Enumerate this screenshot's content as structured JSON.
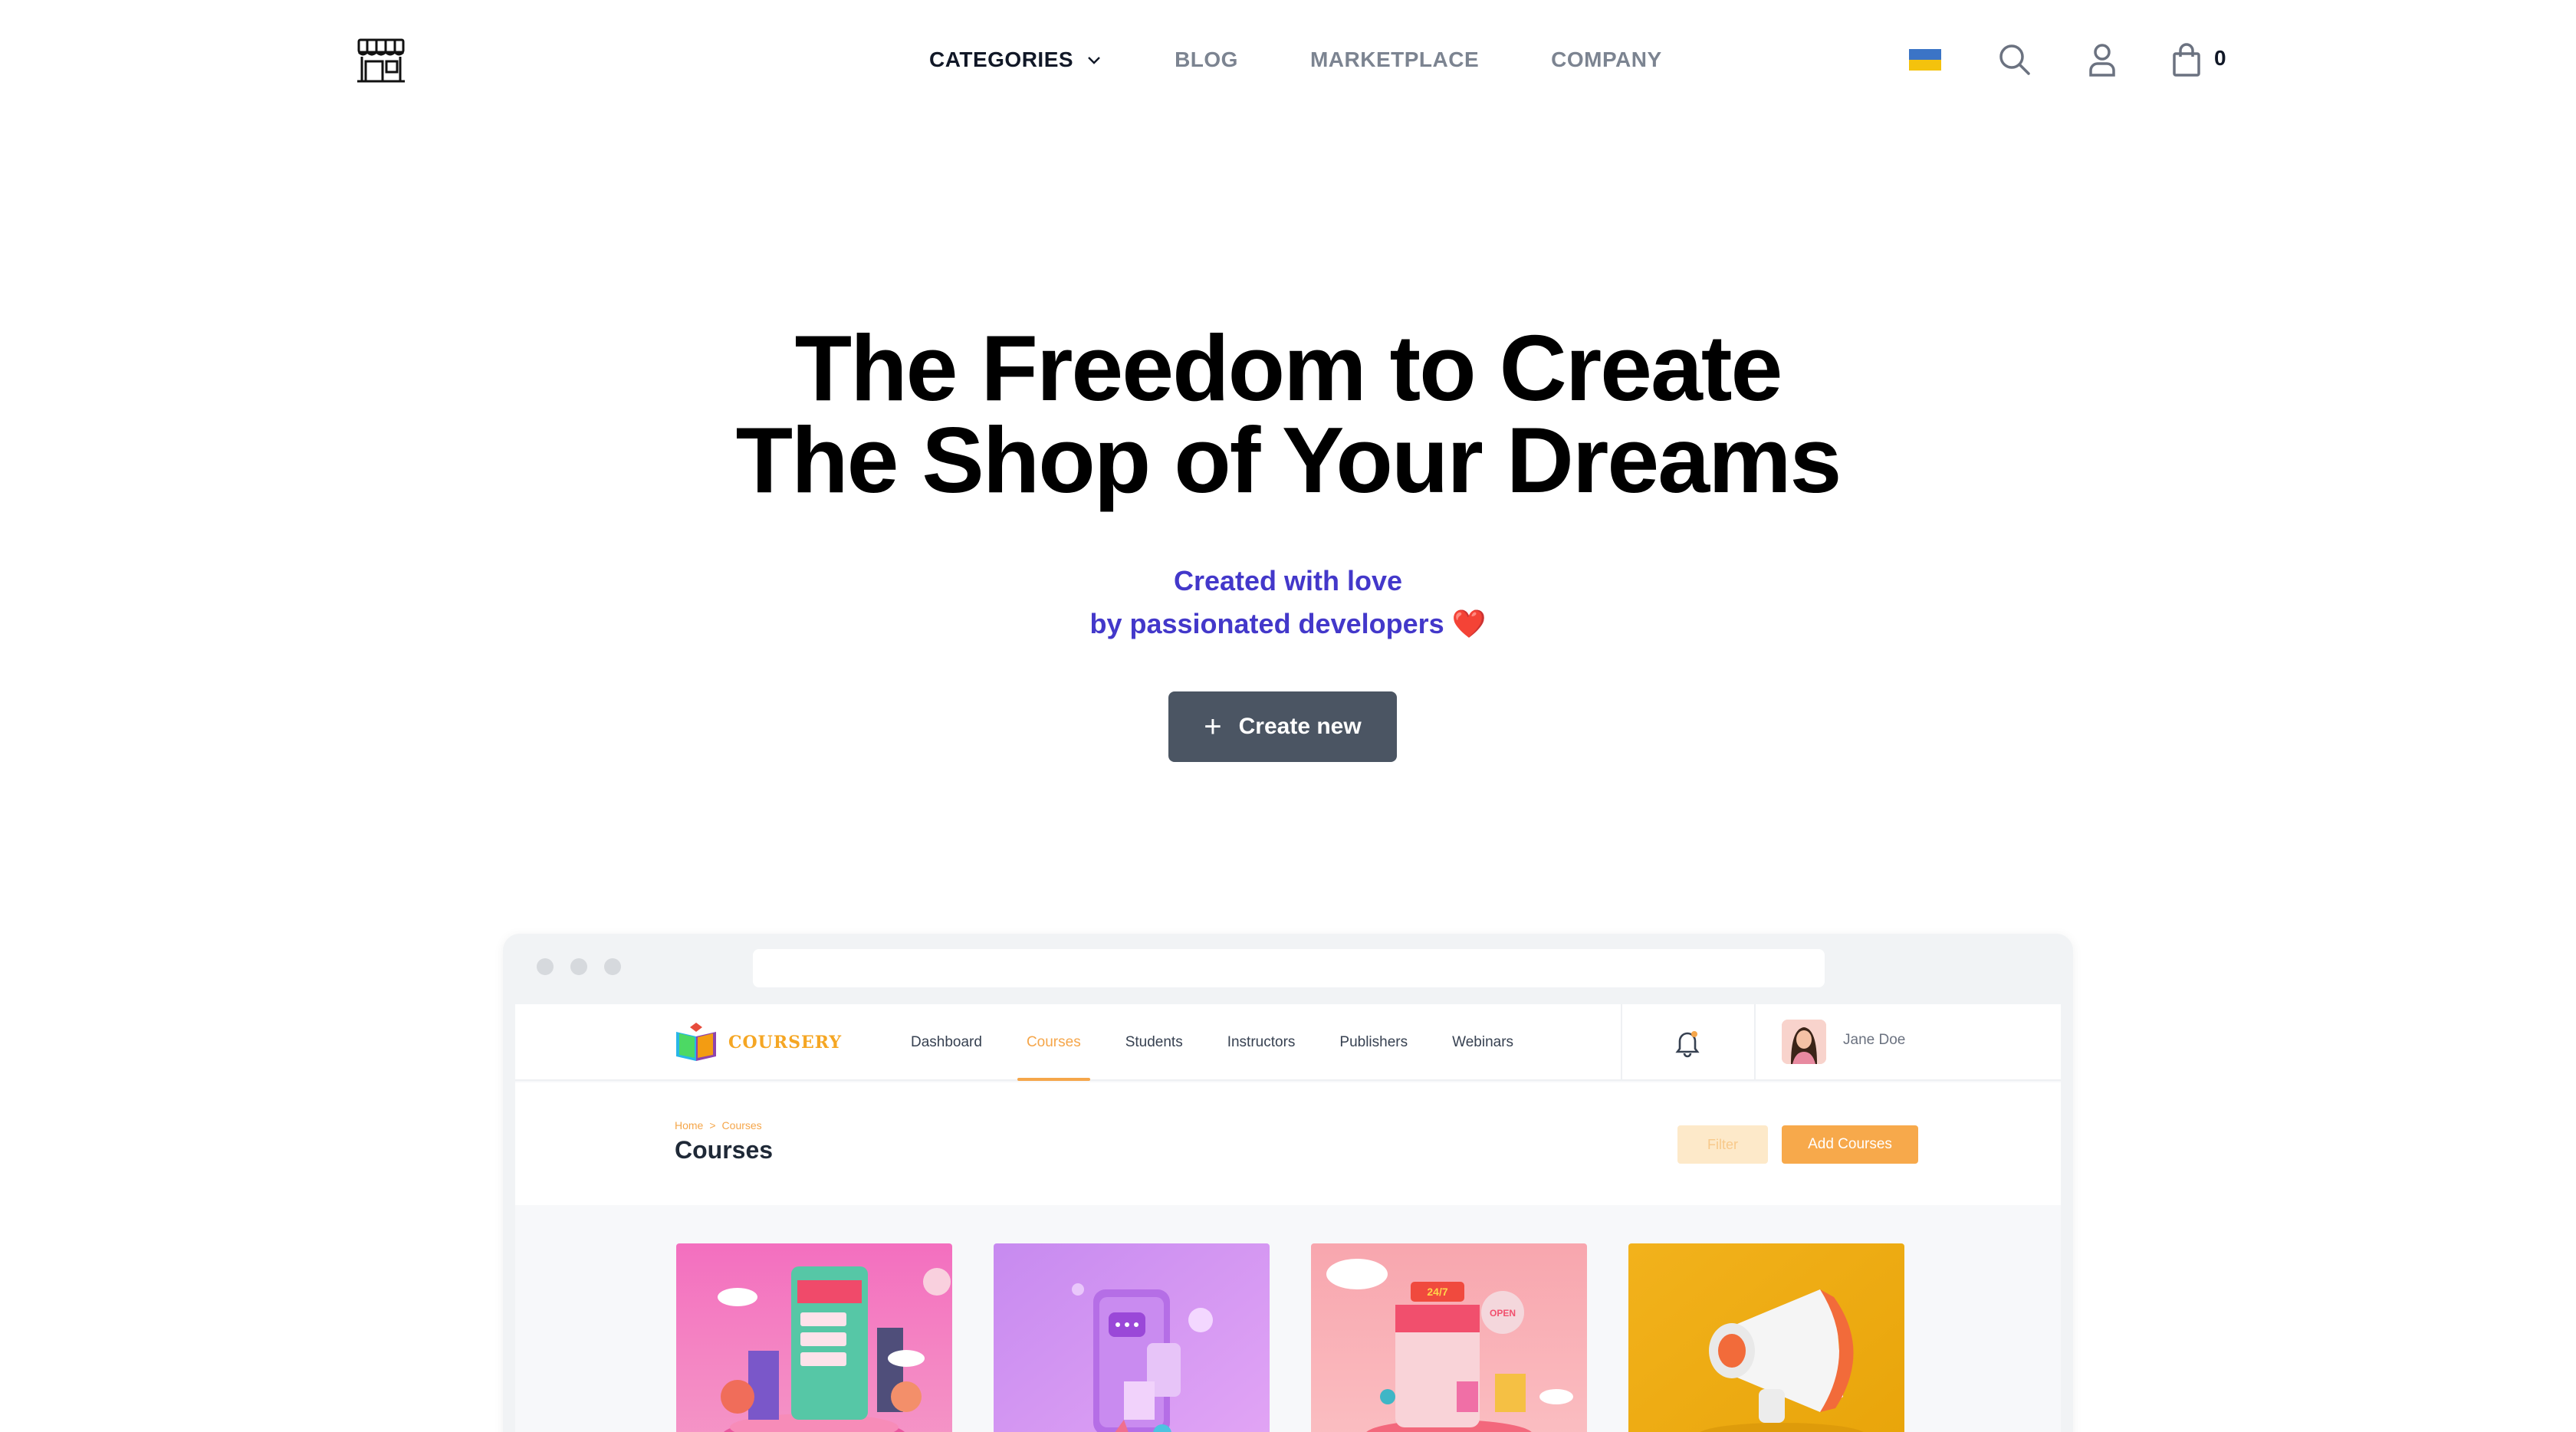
{
  "nav": {
    "links": [
      {
        "label": "CATEGORIES"
      },
      {
        "label": "BLOG"
      },
      {
        "label": "MARKETPLACE"
      },
      {
        "label": "COMPANY"
      }
    ],
    "cart_count": "0",
    "icons": [
      "shop-logo-icon",
      "chevron-down-icon",
      "ukraine-flag-icon",
      "search-icon",
      "user-icon",
      "shopping-bag-icon"
    ]
  },
  "hero": {
    "title_line1": "The Freedom to Create",
    "title_line2": "The Shop of Your Dreams",
    "subtitle_line1": "Created with love",
    "subtitle_line2": "by passionated developers",
    "heart": "❤️",
    "cta_plus": "+",
    "cta_label": "Create new"
  },
  "preview": {
    "brand": "COURSERY",
    "tabs": [
      "Dashboard",
      "Courses",
      "Students",
      "Instructors",
      "Publishers",
      "Webinars"
    ],
    "active_tab": "Courses",
    "user_name": "Jane Doe",
    "breadcrumb": {
      "home": "Home",
      "sep": ">",
      "current": "Courses"
    },
    "page_title": "Courses",
    "filter_label": "Filter",
    "add_label": "Add Courses",
    "cards": [
      {
        "name": "online-shop-illustration"
      },
      {
        "name": "mobile-chat-illustration"
      },
      {
        "name": "open-store-24-7-illustration"
      },
      {
        "name": "megaphone-illustration"
      }
    ]
  },
  "colors": {
    "accent_purple": "#4338ca",
    "button_gray": "#4b5563",
    "preview_orange": "#f5a64a",
    "nav_inactive": "#7c8491"
  }
}
